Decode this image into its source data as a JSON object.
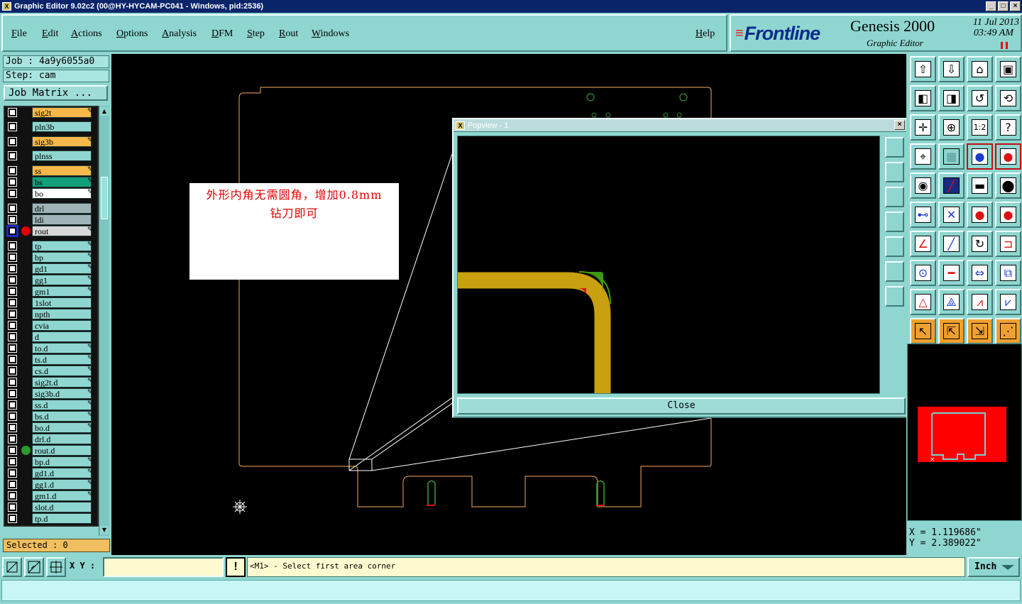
{
  "window": {
    "title": "Graphic Editor 9.02c2 (00@HY-HYCAM-PC041 - Windows, pid:2536)",
    "buttons": [
      "_",
      "□",
      "×"
    ]
  },
  "menu": {
    "items": [
      "File",
      "Edit",
      "Actions",
      "Options",
      "Analysis",
      "DFM",
      "Step",
      "Rout",
      "Windows"
    ],
    "help": "Help"
  },
  "brand": {
    "logo": "Frontline",
    "product": "Genesis 2000",
    "subtitle": "Graphic Editor",
    "date": "11 Jul 2013",
    "time": "03:49 AM"
  },
  "job": {
    "job_line": "Job : 4a9y6055a0",
    "step_line": "Step: cam",
    "matrix_button": "Job Matrix ..."
  },
  "layers": [
    {
      "name": "sig2t",
      "color": "#f6b84a",
      "edit": true,
      "dot": ""
    },
    {
      "name": "pln3b",
      "color": "#8fd6d0",
      "edit": false,
      "dot": ""
    },
    {
      "name": "sig3b",
      "color": "#f6b84a",
      "edit": true,
      "dot": ""
    },
    {
      "name": "plnss",
      "color": "#8fd6d0",
      "edit": false,
      "dot": ""
    },
    {
      "name": "ss",
      "color": "#f6b84a",
      "edit": true,
      "dot": ""
    },
    {
      "name": "bs",
      "color": "#11a07a",
      "edit": true,
      "dot": ""
    },
    {
      "name": "bo",
      "color": "#ffffff",
      "edit": true,
      "dot": ""
    },
    {
      "name": "drl",
      "color": "#a0b4b8",
      "edit": false,
      "dot": ""
    },
    {
      "name": "ldi",
      "color": "#a0b4b8",
      "edit": false,
      "dot": ""
    },
    {
      "name": "rout",
      "color": "#d8d8d8",
      "edit": true,
      "dot": "#e00000"
    },
    {
      "name": "tp",
      "color": "#8fd6d0",
      "edit": true,
      "dot": ""
    },
    {
      "name": "bp",
      "color": "#8fd6d0",
      "edit": true,
      "dot": ""
    },
    {
      "name": "gd1",
      "color": "#8fd6d0",
      "edit": true,
      "dot": ""
    },
    {
      "name": "gg1",
      "color": "#8fd6d0",
      "edit": true,
      "dot": ""
    },
    {
      "name": "gm1",
      "color": "#8fd6d0",
      "edit": true,
      "dot": ""
    },
    {
      "name": "1slot",
      "color": "#8fd6d0",
      "edit": false,
      "dot": ""
    },
    {
      "name": "npth",
      "color": "#8fd6d0",
      "edit": false,
      "dot": ""
    },
    {
      "name": "cvia",
      "color": "#8fd6d0",
      "edit": false,
      "dot": ""
    },
    {
      "name": "d",
      "color": "#8fd6d0",
      "edit": false,
      "dot": ""
    },
    {
      "name": "to.d",
      "color": "#8fd6d0",
      "edit": true,
      "dot": ""
    },
    {
      "name": "ts.d",
      "color": "#8fd6d0",
      "edit": true,
      "dot": ""
    },
    {
      "name": "cs.d",
      "color": "#8fd6d0",
      "edit": true,
      "dot": ""
    },
    {
      "name": "sig2t.d",
      "color": "#8fd6d0",
      "edit": true,
      "dot": ""
    },
    {
      "name": "sig3b.d",
      "color": "#8fd6d0",
      "edit": true,
      "dot": ""
    },
    {
      "name": "ss.d",
      "color": "#8fd6d0",
      "edit": true,
      "dot": ""
    },
    {
      "name": "bs.d",
      "color": "#8fd6d0",
      "edit": true,
      "dot": ""
    },
    {
      "name": "bo.d",
      "color": "#8fd6d0",
      "edit": true,
      "dot": ""
    },
    {
      "name": "drl.d",
      "color": "#8fd6d0",
      "edit": false,
      "dot": ""
    },
    {
      "name": "rout.d",
      "color": "#8fd6d0",
      "edit": false,
      "dot": "#2a9a2a"
    },
    {
      "name": "bp.d",
      "color": "#8fd6d0",
      "edit": true,
      "dot": ""
    },
    {
      "name": "gd1.d",
      "color": "#8fd6d0",
      "edit": true,
      "dot": ""
    },
    {
      "name": "gg1.d",
      "color": "#8fd6d0",
      "edit": true,
      "dot": ""
    },
    {
      "name": "gm1.d",
      "color": "#8fd6d0",
      "edit": true,
      "dot": ""
    },
    {
      "name": "slot.d",
      "color": "#8fd6d0",
      "edit": false,
      "dot": ""
    },
    {
      "name": "tp.d",
      "color": "#8fd6d0",
      "edit": false,
      "dot": ""
    }
  ],
  "selected": "Selected : 0",
  "annotation": {
    "line1": "外形内角无需圆角，增加0.8mm",
    "line2": "钻刀即可"
  },
  "popview": {
    "title": "Popview - 1",
    "close_label": "Close"
  },
  "toolbox": {
    "icons": [
      "zoom-page-icon",
      "zoom-home-icon",
      "zoom-house-icon",
      "zoom-window-icon",
      "pan-left-icon",
      "pan-right-icon",
      "redraw-icon",
      "snap-icon",
      "zoom-fit-icon",
      "zoom-center-icon",
      "scale-1-2-icon",
      "help-icon",
      "measure-icon",
      "grid-icon",
      "layer-blue-icon",
      "layer-red-icon",
      "select-feature-icon",
      "line-red-icon",
      "ruler-icon",
      "pad-icon",
      "connect-nodes-icon",
      "cross-icon",
      "arc-red-icon",
      "arc-blue-icon",
      "angle-icon",
      "line-blue-icon",
      "rotate-icon",
      "mirror-icon",
      "circle-add-icon",
      "minus-red-icon",
      "dimension-icon",
      "shapes-icon",
      "triangle-icon",
      "polygon-icon",
      "arc-poly-icon",
      "arc-poly-blue-icon",
      "pointer-icon",
      "pointer-box-icon",
      "pointer-box2-icon",
      "path-edit-icon"
    ],
    "accent": "#f0a030"
  },
  "coords": {
    "x": "X = 1.119686\"",
    "y": "Y = 2.389022\""
  },
  "status": {
    "xy_label": "X Y :",
    "xy_value": "",
    "prompt": "<M1> - Select first area corner",
    "unit": "Inch"
  }
}
